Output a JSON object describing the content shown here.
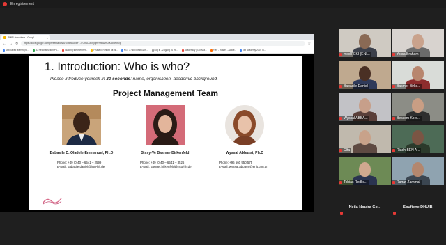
{
  "recording": {
    "label": "Enregistrement"
  },
  "browser": {
    "tab_title": "PMB \\ Introduce - Googl",
    "url": "https://docs.google.com/presentation/d/1cJEfqGewFT-i7Gh4OuwSyqmrPrkdZmDlKAr8e-nk/p",
    "bookmarks": [
      {
        "label": "Self-paced learning fo...",
        "color": "#4285f4"
      },
      {
        "label": "3D Reconstruction Pu...",
        "color": "#34a853"
      },
      {
        "label": "Building the Interpret...",
        "color": "#ea4335"
      },
      {
        "label": "Phase Ill Retrofit Blt W...",
        "color": "#fbbc05"
      },
      {
        "label": "NGT & Wall Limit Gam...",
        "color": "#4285f4"
      },
      {
        "label": "Log in - Zugang zu He...",
        "color": "#9e9e9e"
      },
      {
        "label": "Academicy | Tax Aca...",
        "color": "#ea4335"
      },
      {
        "label": "Free - master - Acade...",
        "color": "#ff6d00"
      },
      {
        "label": "Tax Academy 2020 In...",
        "color": "#4285f4"
      }
    ]
  },
  "slide": {
    "title": "1.  Introduction: Who is who?",
    "subtitle_pre": "Please introduce yourself in ",
    "subtitle_bold": "30 seconds",
    "subtitle_post": ": name, organisation, academic background.",
    "team_heading": "Project Management Team",
    "people": [
      {
        "name": "Babasile D. Oladele-Emmanuel, Ph.D",
        "phone": "Phone: +49 (0)40 – 6541 – 2599",
        "email": "E-Mail: babasile.daniel@hsu-hh.de"
      },
      {
        "name": "Sissy-Ve Basmer-Birkenfeld",
        "phone": "Phone: +49 (0)40 – 6541 – 3526",
        "email": "E-Mail: basmer.birkenfeld@hsu-hh.de"
      },
      {
        "name": "Wyssal Abbassi, Ph.D",
        "phone": "Phone: +96 560 950 575",
        "email": "E-Mail: wyssal.abbassi@enit.utm.tn"
      }
    ]
  },
  "participants": [
    {
      "name": "med FEKI (ENI...",
      "bg": "#cfcac2",
      "skin": "#8a6a55",
      "shirt": "#3b3f4a"
    },
    {
      "name": "Yosra Braham",
      "bg": "#d8d3cf",
      "skin": "#c9a28c",
      "shirt": "#6b6b6b"
    },
    {
      "name": "Babasile Daniel",
      "bg": "#bfa98f",
      "skin": "#4a3024",
      "shirt": "#2f3a5a"
    },
    {
      "name": "Basmer-Birke...",
      "bg": "#d9dcd8",
      "skin": "#b8866e",
      "shirt": "#8d2d2d"
    },
    {
      "name": "Wyssal ABBA...",
      "bg": "#c2c2c6",
      "skin": "#c79f8a",
      "shirt": "#5a3f3a"
    },
    {
      "name": "Bessem Kord...",
      "bg": "#8c8d86",
      "skin": "#c99e84",
      "shirt": "#2e2e2e"
    },
    {
      "name": "Olfa",
      "bg": "#c0b9ad",
      "skin": "#c8a28a",
      "shirt": "#5e4a42"
    },
    {
      "name": "Riadh BEN A...",
      "bg": "#4d6b56",
      "skin": "#7b5544",
      "shirt": "#2b3a2b"
    },
    {
      "name": "Tobias Redlic...",
      "bg": "#6d8a55",
      "skin": "#d0a890",
      "shirt": "#2a3350"
    },
    {
      "name": "Ramzi Zammal",
      "bg": "#8fa3b0",
      "skin": "#b3876e",
      "shirt": "#3b4651"
    }
  ],
  "placeholders": [
    {
      "name": "Neila Nouira Go..."
    },
    {
      "name": "Soufiene DHUIB"
    }
  ],
  "colors": {
    "mic_muted": "#e53935",
    "recording": "#e53935"
  }
}
